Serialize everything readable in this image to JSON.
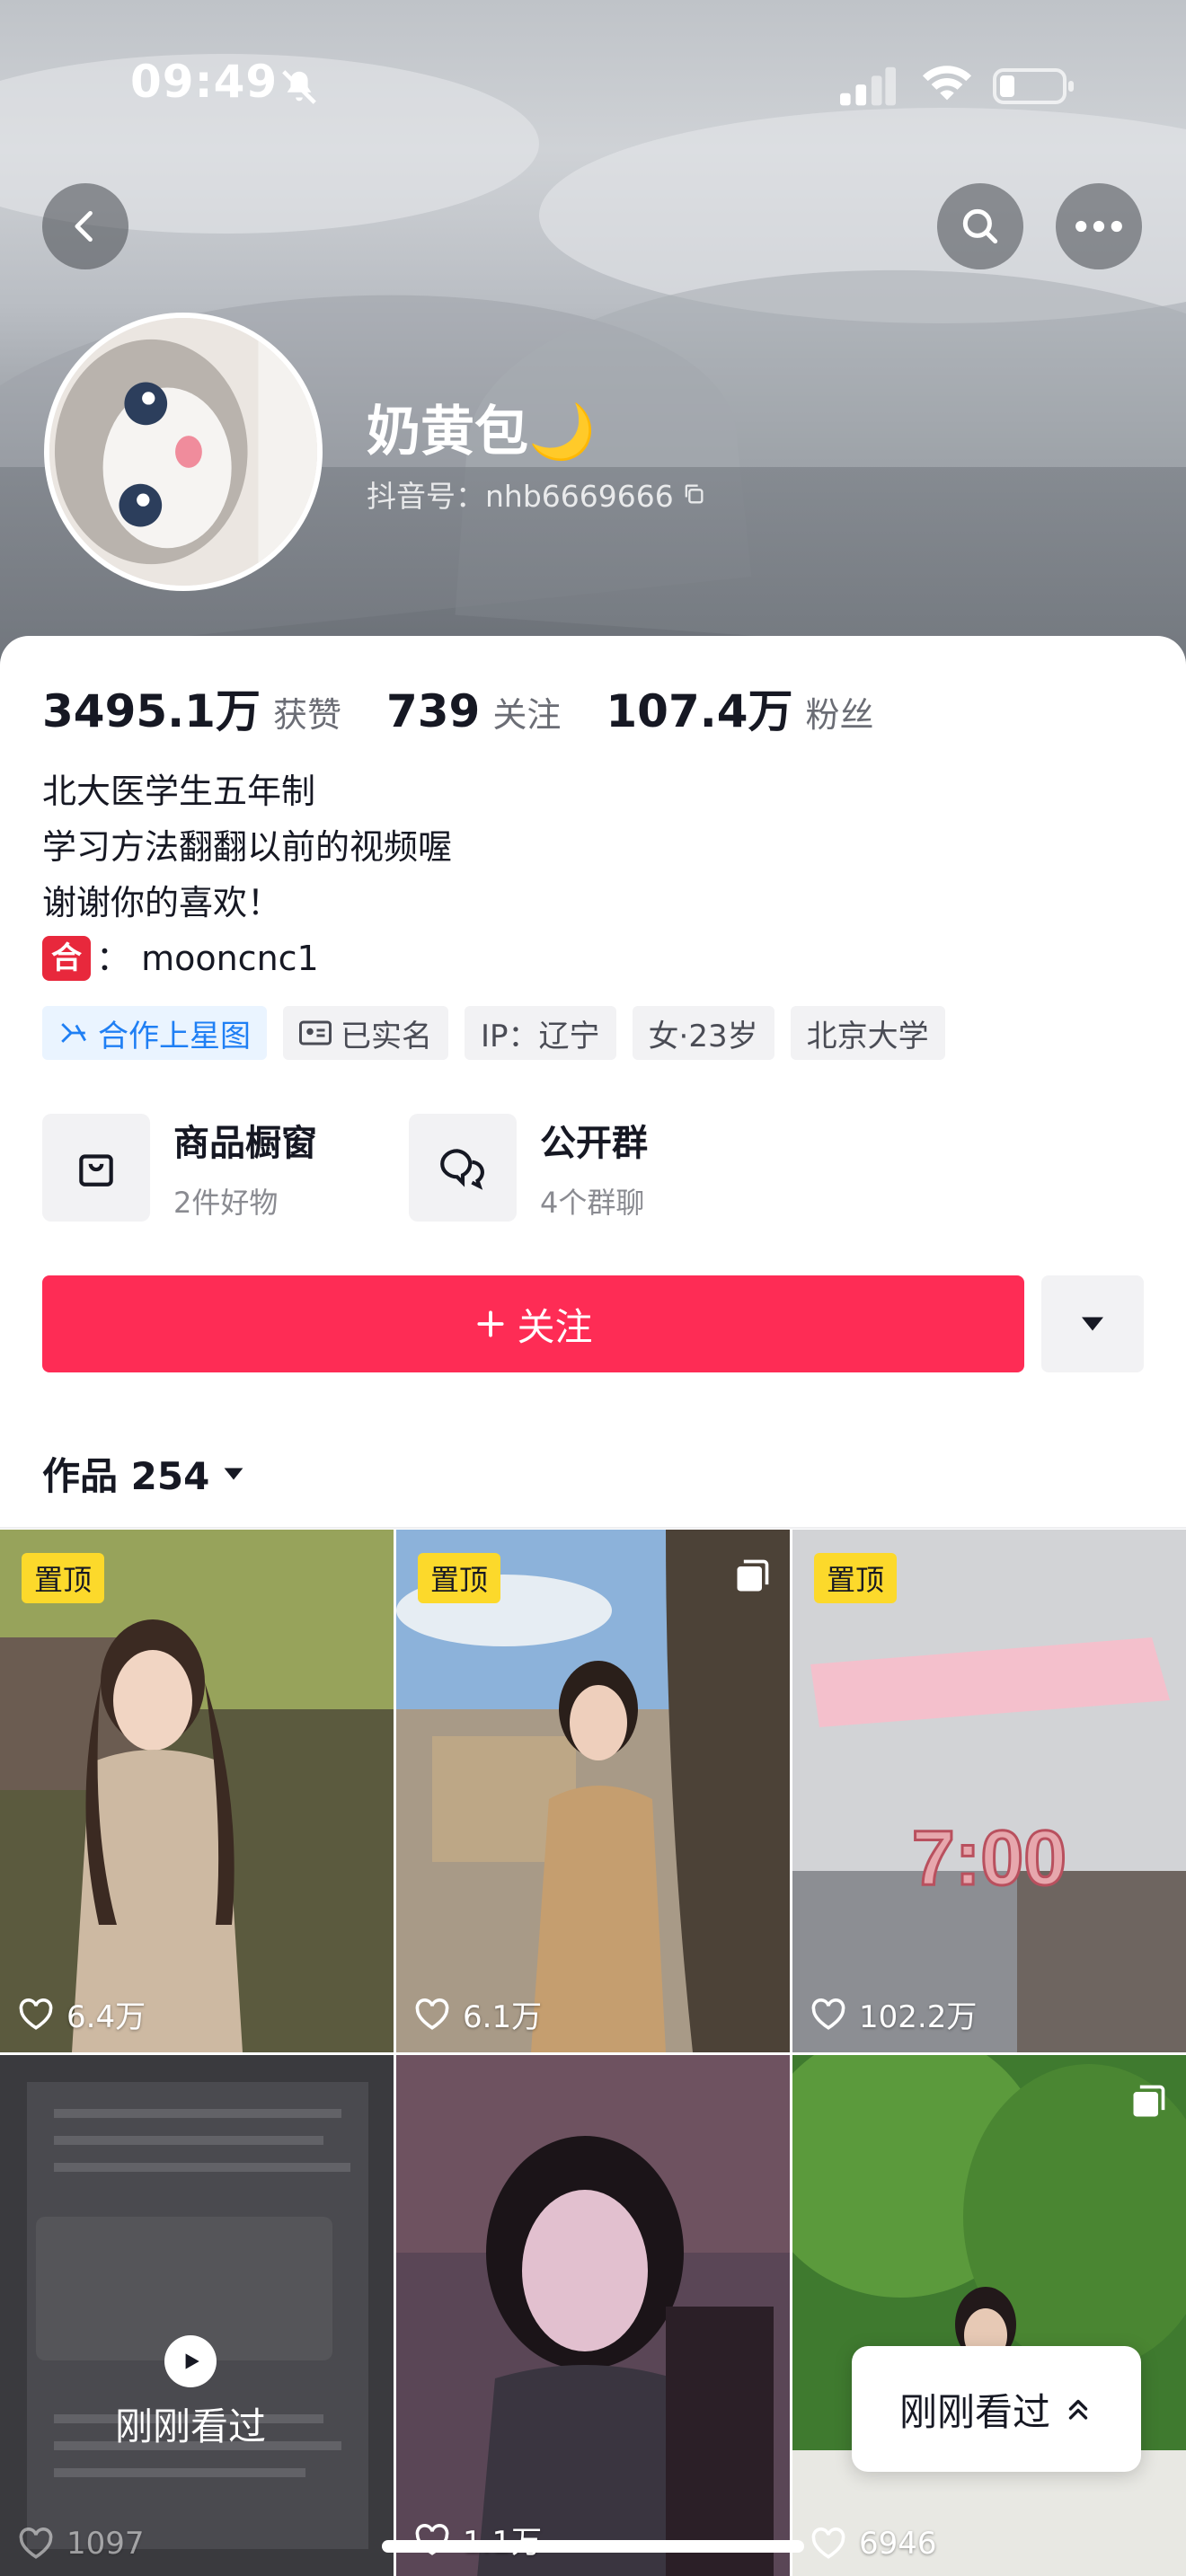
{
  "status_bar": {
    "time": "09:49"
  },
  "profile": {
    "nickname": "奶黄包🌙",
    "douyin_id": "抖音号：nhb6669666",
    "stats": [
      {
        "value": "3495.1万",
        "label": "获赞"
      },
      {
        "value": "739",
        "label": "关注"
      },
      {
        "value": "107.4万",
        "label": "粉丝"
      }
    ],
    "bio": {
      "line1": "北大医学生五年制",
      "line2": "学习方法翻翻以前的视频喔",
      "line3": "谢谢你的喜欢！",
      "badge": "合",
      "line4": "：  mooncnc1"
    },
    "tags": {
      "star": "合作上星图",
      "realname": "已实名",
      "ip": "IP：辽宁",
      "gender_age": "女·23岁",
      "school": "北京大学"
    }
  },
  "services": {
    "shop_title": "商品橱窗",
    "shop_sub": "2件好物",
    "group_title": "公开群",
    "group_sub": "4个群聊"
  },
  "actions": {
    "follow": "关注"
  },
  "works": {
    "tab_label": "作品 254",
    "pin_label": "置顶",
    "items": [
      {
        "likes": "6.4万",
        "pinned": true
      },
      {
        "likes": "6.1万",
        "pinned": true
      },
      {
        "likes": "102.2万",
        "pinned": true,
        "overlay_time": "7:00"
      },
      {
        "likes": "1097",
        "pinned": false
      },
      {
        "likes": "1.1万",
        "pinned": false
      },
      {
        "likes": "6946",
        "pinned": false
      }
    ],
    "recent_overlay": "刚刚看过",
    "recent_button": "刚刚看过"
  },
  "colors": {
    "follow": "#fe2c55",
    "pin": "#fcd92b",
    "star_tag": "#1f7ff4"
  }
}
